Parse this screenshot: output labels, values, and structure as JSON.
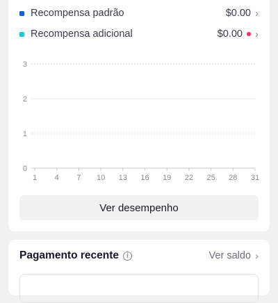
{
  "legend": [
    {
      "label": "Recompensa padrão",
      "value": "$0.00",
      "color": "#1d5fd1",
      "alert_dot": false
    },
    {
      "label": "Recompensa adicional",
      "value": "$0.00",
      "color": "#22c7d6",
      "alert_dot": true,
      "dot_color": "#fe2c55"
    }
  ],
  "chart_data": {
    "type": "line",
    "x_ticks": [
      "1",
      "4",
      "7",
      "10",
      "13",
      "16",
      "19",
      "22",
      "25",
      "28",
      "31"
    ],
    "y_ticks": [
      "0",
      "1",
      "2",
      "3"
    ],
    "ylim": [
      0,
      3
    ],
    "xlim": [
      1,
      31
    ],
    "grid": true,
    "series": [
      {
        "color": "#1d5fd1",
        "values": []
      },
      {
        "color": "#22c7d6",
        "values": []
      }
    ]
  },
  "performance_button": {
    "label": "Ver desempenho"
  },
  "recent_payment": {
    "title": "Pagamento recente",
    "info_icon": "i",
    "see_balance_label": "Ver saldo",
    "chevron": "›"
  },
  "chevron": "›"
}
